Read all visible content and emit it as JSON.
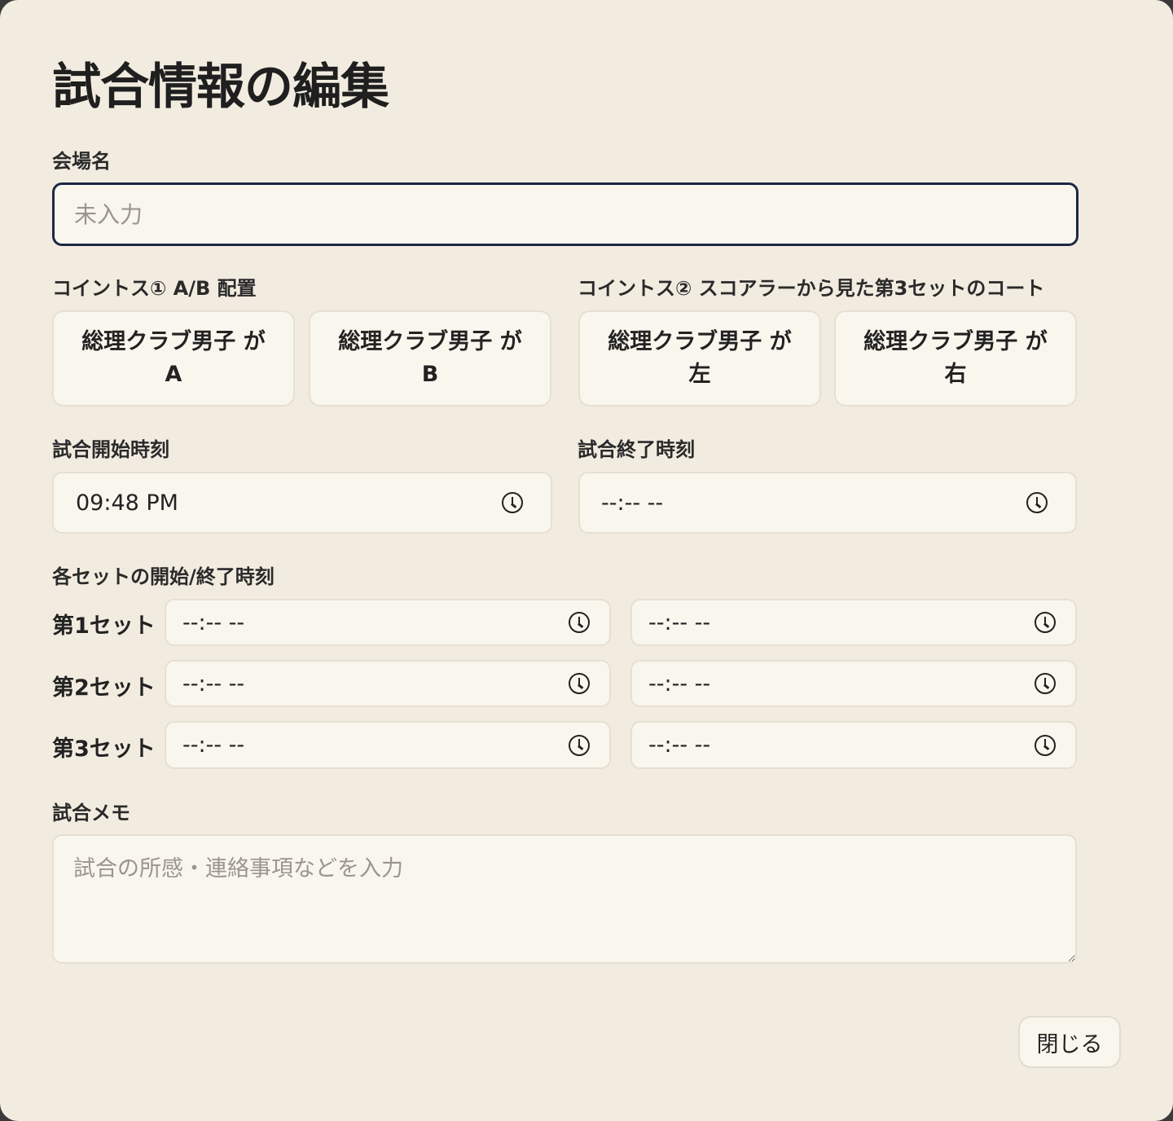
{
  "dialog": {
    "title": "試合情報の編集",
    "venue": {
      "label": "会場名",
      "placeholder": "未入力",
      "value": ""
    },
    "cointoss1": {
      "label": "コイントス① A/B 配置",
      "options": [
        {
          "line1": "総理クラブ男子 が",
          "line2": "A"
        },
        {
          "line1": "総理クラブ男子 が",
          "line2": "B"
        }
      ]
    },
    "cointoss2": {
      "label": "コイントス② スコアラーから見た第3セットのコート",
      "options": [
        {
          "line1": "総理クラブ男子 が",
          "line2": "左"
        },
        {
          "line1": "総理クラブ男子 が",
          "line2": "右"
        }
      ]
    },
    "start_time": {
      "label": "試合開始時刻",
      "value": "09:48 PM"
    },
    "end_time": {
      "label": "試合終了時刻",
      "value": "--:-- --"
    },
    "sets": {
      "label": "各セットの開始/終了時刻",
      "rows": [
        {
          "name": "第1セット",
          "start": "--:-- --",
          "end": "--:-- --"
        },
        {
          "name": "第2セット",
          "start": "--:-- --",
          "end": "--:-- --"
        },
        {
          "name": "第3セット",
          "start": "--:-- --",
          "end": "--:-- --"
        }
      ]
    },
    "memo": {
      "label": "試合メモ",
      "placeholder": "試合の所感・連絡事項などを入力"
    },
    "close_label": "閉じる"
  }
}
